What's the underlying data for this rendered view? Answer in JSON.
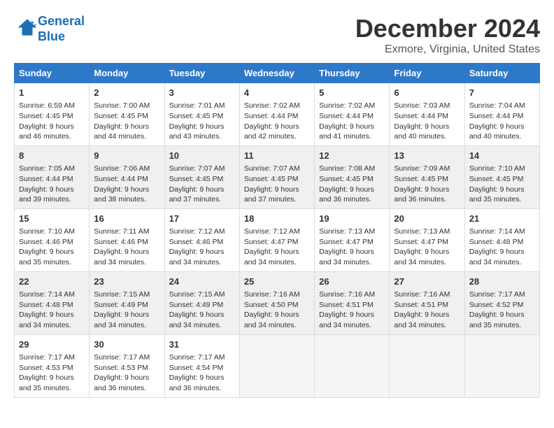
{
  "header": {
    "logo_line1": "General",
    "logo_line2": "Blue",
    "title": "December 2024",
    "subtitle": "Exmore, Virginia, United States"
  },
  "weekdays": [
    "Sunday",
    "Monday",
    "Tuesday",
    "Wednesday",
    "Thursday",
    "Friday",
    "Saturday"
  ],
  "weeks": [
    [
      {
        "day": "1",
        "sunrise": "6:59 AM",
        "sunset": "4:45 PM",
        "daylight": "9 hours and 46 minutes."
      },
      {
        "day": "2",
        "sunrise": "7:00 AM",
        "sunset": "4:45 PM",
        "daylight": "9 hours and 44 minutes."
      },
      {
        "day": "3",
        "sunrise": "7:01 AM",
        "sunset": "4:45 PM",
        "daylight": "9 hours and 43 minutes."
      },
      {
        "day": "4",
        "sunrise": "7:02 AM",
        "sunset": "4:44 PM",
        "daylight": "9 hours and 42 minutes."
      },
      {
        "day": "5",
        "sunrise": "7:02 AM",
        "sunset": "4:44 PM",
        "daylight": "9 hours and 41 minutes."
      },
      {
        "day": "6",
        "sunrise": "7:03 AM",
        "sunset": "4:44 PM",
        "daylight": "9 hours and 40 minutes."
      },
      {
        "day": "7",
        "sunrise": "7:04 AM",
        "sunset": "4:44 PM",
        "daylight": "9 hours and 40 minutes."
      }
    ],
    [
      {
        "day": "8",
        "sunrise": "7:05 AM",
        "sunset": "4:44 PM",
        "daylight": "9 hours and 39 minutes."
      },
      {
        "day": "9",
        "sunrise": "7:06 AM",
        "sunset": "4:44 PM",
        "daylight": "9 hours and 38 minutes."
      },
      {
        "day": "10",
        "sunrise": "7:07 AM",
        "sunset": "4:45 PM",
        "daylight": "9 hours and 37 minutes."
      },
      {
        "day": "11",
        "sunrise": "7:07 AM",
        "sunset": "4:45 PM",
        "daylight": "9 hours and 37 minutes."
      },
      {
        "day": "12",
        "sunrise": "7:08 AM",
        "sunset": "4:45 PM",
        "daylight": "9 hours and 36 minutes."
      },
      {
        "day": "13",
        "sunrise": "7:09 AM",
        "sunset": "4:45 PM",
        "daylight": "9 hours and 36 minutes."
      },
      {
        "day": "14",
        "sunrise": "7:10 AM",
        "sunset": "4:45 PM",
        "daylight": "9 hours and 35 minutes."
      }
    ],
    [
      {
        "day": "15",
        "sunrise": "7:10 AM",
        "sunset": "4:46 PM",
        "daylight": "9 hours and 35 minutes."
      },
      {
        "day": "16",
        "sunrise": "7:11 AM",
        "sunset": "4:46 PM",
        "daylight": "9 hours and 34 minutes."
      },
      {
        "day": "17",
        "sunrise": "7:12 AM",
        "sunset": "4:46 PM",
        "daylight": "9 hours and 34 minutes."
      },
      {
        "day": "18",
        "sunrise": "7:12 AM",
        "sunset": "4:47 PM",
        "daylight": "9 hours and 34 minutes."
      },
      {
        "day": "19",
        "sunrise": "7:13 AM",
        "sunset": "4:47 PM",
        "daylight": "9 hours and 34 minutes."
      },
      {
        "day": "20",
        "sunrise": "7:13 AM",
        "sunset": "4:47 PM",
        "daylight": "9 hours and 34 minutes."
      },
      {
        "day": "21",
        "sunrise": "7:14 AM",
        "sunset": "4:48 PM",
        "daylight": "9 hours and 34 minutes."
      }
    ],
    [
      {
        "day": "22",
        "sunrise": "7:14 AM",
        "sunset": "4:48 PM",
        "daylight": "9 hours and 34 minutes."
      },
      {
        "day": "23",
        "sunrise": "7:15 AM",
        "sunset": "4:49 PM",
        "daylight": "9 hours and 34 minutes."
      },
      {
        "day": "24",
        "sunrise": "7:15 AM",
        "sunset": "4:49 PM",
        "daylight": "9 hours and 34 minutes."
      },
      {
        "day": "25",
        "sunrise": "7:16 AM",
        "sunset": "4:50 PM",
        "daylight": "9 hours and 34 minutes."
      },
      {
        "day": "26",
        "sunrise": "7:16 AM",
        "sunset": "4:51 PM",
        "daylight": "9 hours and 34 minutes."
      },
      {
        "day": "27",
        "sunrise": "7:16 AM",
        "sunset": "4:51 PM",
        "daylight": "9 hours and 34 minutes."
      },
      {
        "day": "28",
        "sunrise": "7:17 AM",
        "sunset": "4:52 PM",
        "daylight": "9 hours and 35 minutes."
      }
    ],
    [
      {
        "day": "29",
        "sunrise": "7:17 AM",
        "sunset": "4:53 PM",
        "daylight": "9 hours and 35 minutes."
      },
      {
        "day": "30",
        "sunrise": "7:17 AM",
        "sunset": "4:53 PM",
        "daylight": "9 hours and 36 minutes."
      },
      {
        "day": "31",
        "sunrise": "7:17 AM",
        "sunset": "4:54 PM",
        "daylight": "9 hours and 36 minutes."
      },
      null,
      null,
      null,
      null
    ]
  ]
}
